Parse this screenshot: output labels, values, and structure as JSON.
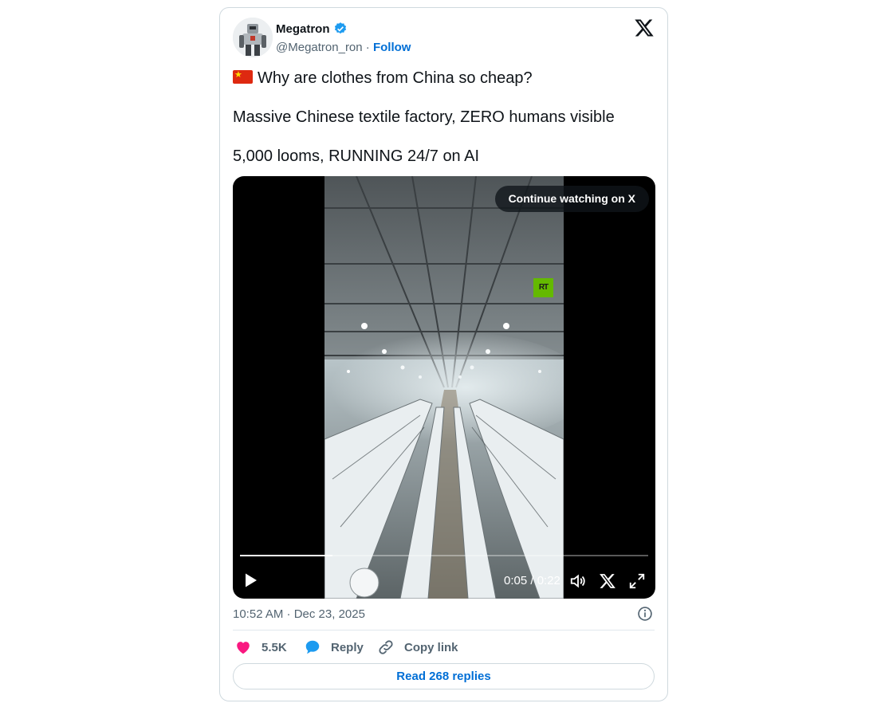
{
  "author": {
    "name": "Megatron",
    "handle": "@Megatron_ron",
    "separator": "·",
    "follow_label": "Follow",
    "verified": true
  },
  "tweet": {
    "flag_icon": "china-flag-emoji",
    "lines": [
      "Why are clothes from China so cheap?",
      "Massive Chinese textile factory, ZERO humans visible",
      "5,000 looms, RUNNING 24/7 on AI"
    ],
    "timestamp": "10:52 AM · Dec 23, 2025"
  },
  "video": {
    "continue_label": "Continue watching on X",
    "watermark": "RT",
    "current_time": "0:05",
    "duration": "0:22",
    "time_display": "0:05 / 0:22",
    "progress_fraction": 0.227
  },
  "actions": {
    "likes": "5.5K",
    "reply_label": "Reply",
    "copy_link_label": "Copy link",
    "read_replies_label": "Read 268 replies"
  },
  "colors": {
    "accent": "#006fd6",
    "like": "#f91880",
    "verified": "#1d9bf0",
    "text_secondary": "#536471"
  }
}
